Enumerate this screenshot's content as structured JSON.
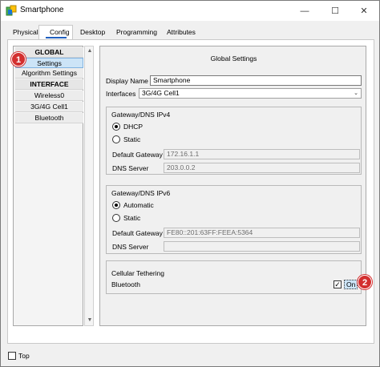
{
  "window": {
    "title": "Smartphone",
    "minimize_glyph": "—",
    "maximize_glyph": "☐",
    "close_glyph": "✕"
  },
  "tabs": [
    {
      "label": "Physical"
    },
    {
      "label": "Config"
    },
    {
      "label": "Desktop"
    },
    {
      "label": "Programming"
    },
    {
      "label": "Attributes"
    }
  ],
  "nav": {
    "items": [
      {
        "label": "GLOBAL"
      },
      {
        "label": "Settings"
      },
      {
        "label": "Algorithm Settings"
      },
      {
        "label": "INTERFACE"
      },
      {
        "label": "Wireless0"
      },
      {
        "label": "3G/4G Cell1"
      },
      {
        "label": "Bluetooth"
      }
    ]
  },
  "settings": {
    "title": "Global Settings",
    "display_name_label": "Display Name",
    "display_name_value": "Smartphone",
    "interfaces_label": "Interfaces",
    "interfaces_value": "3G/4G Cell1",
    "ipv4": {
      "group_label": "Gateway/DNS IPv4",
      "option1": "DHCP",
      "option2": "Static",
      "gateway_label": "Default Gateway",
      "gateway_value": "172.16.1.1",
      "dns_label": "DNS Server",
      "dns_value": "203.0.0.2"
    },
    "ipv6": {
      "group_label": "Gateway/DNS IPv6",
      "option1": "Automatic",
      "option2": "Static",
      "gateway_label": "Default Gateway",
      "gateway_value": "FE80::201:63FF:FEEA:5364",
      "dns_label": "DNS Server",
      "dns_value": ""
    },
    "tethering": {
      "group_label": "Cellular Tethering",
      "bluetooth_label": "Bluetooth",
      "checkbox_mark": "✓",
      "on_label": "On"
    }
  },
  "markers": {
    "first": "1",
    "second": "2"
  },
  "bottom": {
    "top_label": "Top"
  },
  "colors": {
    "accent": "#1f5fbf",
    "marker": "#d32f2f",
    "selected": "#cce4f7"
  }
}
